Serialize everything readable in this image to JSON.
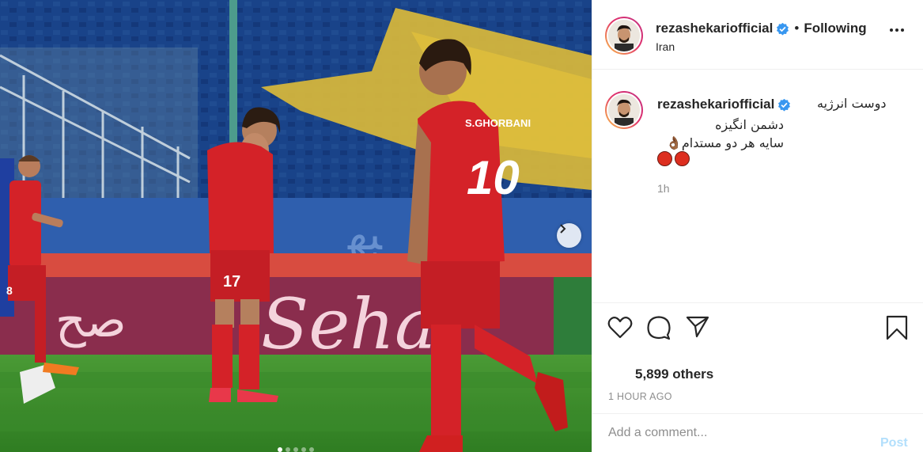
{
  "post": {
    "username": "rezashekariofficial",
    "verified": true,
    "follow_label": "Following",
    "separator": "•",
    "location": "Iran",
    "more_icon": "more-options-icon"
  },
  "caption": {
    "username": "rezashekariofficial",
    "line1": "دوست انرژیه",
    "line2": "دشمن انگیزه",
    "line3": "سایه هر دو مستدام👌🏾",
    "emoji_row": [
      "red-circle",
      "red-circle"
    ],
    "time_ago": "1h"
  },
  "actions": {
    "icons": [
      "heart-icon",
      "comment-icon",
      "share-icon",
      "bookmark-icon"
    ],
    "likes_text": "5,899 others",
    "posted": "1 HOUR AGO"
  },
  "comment": {
    "placeholder": "Add a comment...",
    "post_label": "Post"
  },
  "media": {
    "carousel_count": 5,
    "carousel_active": 1,
    "jersey_numbers": [
      "17",
      "8",
      "10"
    ],
    "jersey_name": "S.GHORBANI",
    "banner_text": "Seha",
    "colors": {
      "team_red": "#d42228",
      "pitch": "#3f8f2a",
      "stands": "#1d4d94",
      "flag_yellow": "#e7c43a"
    }
  },
  "colors": {
    "text": "#262626",
    "muted": "#8e8e8e",
    "verified": "#3897f0",
    "post_disabled": "#b2dffc"
  }
}
